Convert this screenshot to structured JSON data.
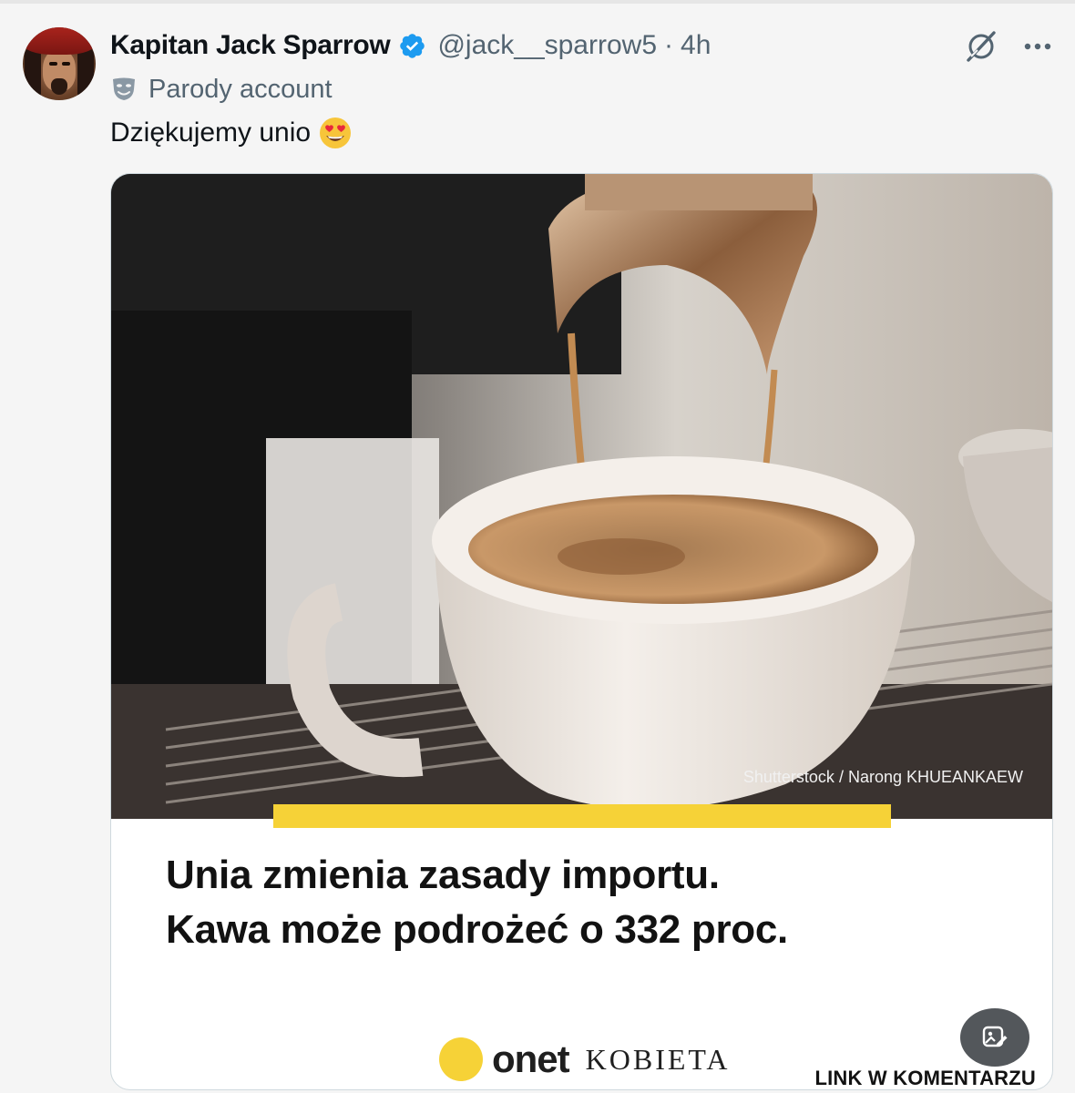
{
  "tweet": {
    "display_name": "Kapitan Jack Sparrow",
    "handle": "@jack__sparrow5",
    "separator": "·",
    "time": "4h",
    "label": "Parody account",
    "text": "Dziękujemy unio",
    "emoji": "smiling-face-with-heart-eyes"
  },
  "media": {
    "photo_credit": "Shutterstock / Narong KHUEANKAEW",
    "headline_line1": "Unia zmienia zasady importu.",
    "headline_line2": "Kawa może podrożeć o 332 proc.",
    "brand_onet": "onet",
    "brand_kobieta": "KOBIETA",
    "link_note": "LINK W KOMENTARZU"
  },
  "colors": {
    "verified_blue": "#1d9bf0",
    "secondary_text": "#536471",
    "onet_yellow": "#f6d237"
  },
  "icons": [
    "verified-badge-icon",
    "grok-icon",
    "more-icon",
    "parody-mask-icon",
    "image-alt-icon"
  ]
}
